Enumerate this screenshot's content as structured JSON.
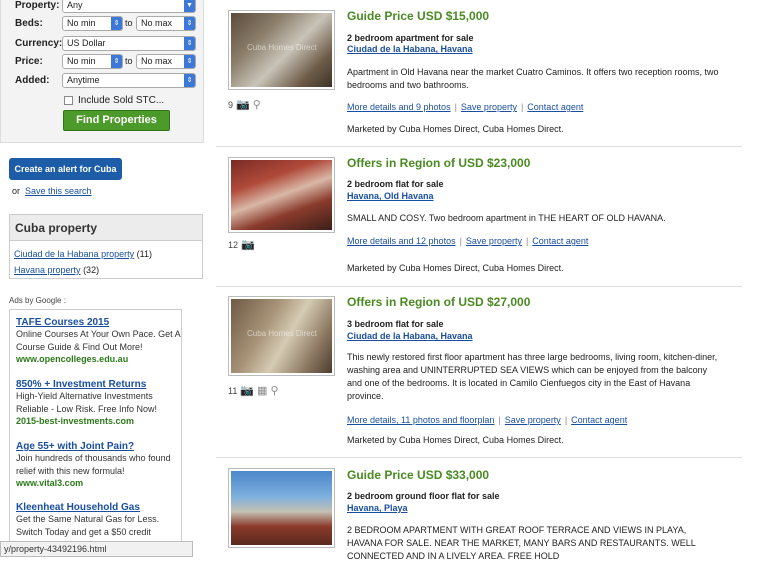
{
  "search": {
    "property_label": "Property:",
    "property_value": "Any",
    "beds_label": "Beds:",
    "beds_min": "No min",
    "beds_to": "to",
    "beds_max": "No max",
    "currency_label": "Currency:",
    "currency_value": "US Dollar",
    "price_label": "Price:",
    "price_min": "No min",
    "price_to": "to",
    "price_max": "No max",
    "added_label": "Added:",
    "added_value": "Anytime",
    "include_sold": "Include Sold STC...",
    "find_button": "Find Properties"
  },
  "alert": {
    "button": "Create an alert for Cuba",
    "or": "or",
    "save_search": "Save this search"
  },
  "cuba_property": {
    "title": "Cuba property",
    "links": [
      {
        "label": "Ciudad de la Habana property",
        "count": "(11)"
      },
      {
        "label": "Havana property",
        "count": "(32)"
      }
    ]
  },
  "ads": {
    "label": "Ads by Google :",
    "items": [
      {
        "title": "TAFE Courses 2015",
        "desc": "Online Courses At Your Own Pace. Get A Course Guide & Find Out More!",
        "url": "www.opencolleges.edu.au"
      },
      {
        "title": "850% + Investment Returns",
        "desc": "High-Yield Alternative Investments Reliable - Low Risk. Free Info Now!",
        "url": "2015-best-investments.com"
      },
      {
        "title": "Age 55+ with Joint Pain?",
        "desc": "Join hundreds of thousands who found relief with this new formula!",
        "url": "www.vital3.com"
      },
      {
        "title": "Kleenheat Household Gas",
        "desc": "Get the Same Natural Gas for Less. Switch Today and get a $50 credit",
        "url": ""
      }
    ]
  },
  "listings": [
    {
      "price": "Guide Price USD $15,000",
      "type": "2 bedroom apartment for sale",
      "location": "Ciudad de la Habana, Havana",
      "desc": "Apartment in Old Havana near the market Cuatro Caminos. It offers two reception rooms, two bedrooms and two bathrooms.",
      "links": [
        "More details and 9 photos",
        "Save property",
        "Contact agent"
      ],
      "marketed": "Marketed by Cuba Homes Direct, Cuba Homes Direct.",
      "photos": "9",
      "watermark": "Cuba Homes Direct"
    },
    {
      "price": "Offers in Region of USD $23,000",
      "type": "2 bedroom flat for sale",
      "location": "Havana, Old Havana",
      "desc": "SMALL AND COSY. Two bedroom apartment in THE HEART OF OLD HAVANA.",
      "links": [
        "More details and 12 photos",
        "Save property",
        "Contact agent"
      ],
      "marketed": "Marketed by Cuba Homes Direct, Cuba Homes Direct.",
      "photos": "12",
      "watermark": ""
    },
    {
      "price": "Offers in Region of USD $27,000",
      "type": "3 bedroom flat for sale",
      "location": "Ciudad de la Habana, Havana",
      "desc": "This newly restored first floor apartment has three large bedrooms, living room, kitchen-diner, washing area and UNINTERRUPTED SEA VIEWS which can be enjoyed from the balcony and one of the bedrooms. It is located in Camilo Cienfuegos city in the East of Havana province.",
      "links": [
        "More details, 11 photos and floorplan",
        "Save property",
        "Contact agent"
      ],
      "marketed": "Marketed by Cuba Homes Direct, Cuba Homes Direct.",
      "photos": "11",
      "watermark": "Cuba Homes Direct"
    },
    {
      "price": "Guide Price USD $33,000",
      "type": "2 bedroom ground floor flat for sale",
      "location": "Havana, Playa",
      "desc": "2 BEDROOM APARTMENT WITH GREAT ROOF TERRACE AND VIEWS IN PLAYA, HAVANA FOR SALE. NEAR THE MARKET, MANY BARS AND RESTAURANTS. WELL CONNECTED AND IN A LIVELY AREA. FREE HOLD",
      "links": [],
      "marketed": "",
      "photos": "",
      "watermark": ""
    }
  ],
  "status_bar": "y/property-43492196.html"
}
